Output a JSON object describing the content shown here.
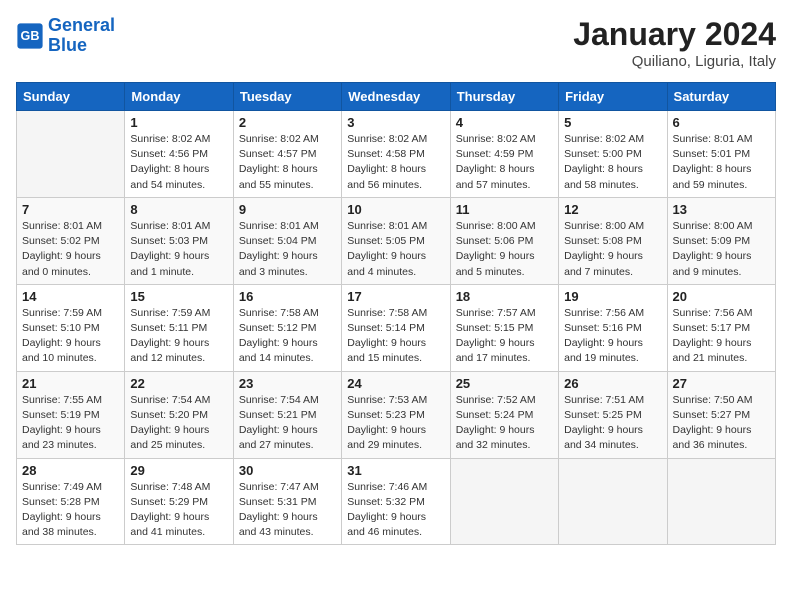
{
  "header": {
    "logo_general": "General",
    "logo_blue": "Blue",
    "month": "January 2024",
    "location": "Quiliano, Liguria, Italy"
  },
  "columns": [
    "Sunday",
    "Monday",
    "Tuesday",
    "Wednesday",
    "Thursday",
    "Friday",
    "Saturday"
  ],
  "weeks": [
    [
      {
        "day": "",
        "info": ""
      },
      {
        "day": "1",
        "info": "Sunrise: 8:02 AM\nSunset: 4:56 PM\nDaylight: 8 hours\nand 54 minutes."
      },
      {
        "day": "2",
        "info": "Sunrise: 8:02 AM\nSunset: 4:57 PM\nDaylight: 8 hours\nand 55 minutes."
      },
      {
        "day": "3",
        "info": "Sunrise: 8:02 AM\nSunset: 4:58 PM\nDaylight: 8 hours\nand 56 minutes."
      },
      {
        "day": "4",
        "info": "Sunrise: 8:02 AM\nSunset: 4:59 PM\nDaylight: 8 hours\nand 57 minutes."
      },
      {
        "day": "5",
        "info": "Sunrise: 8:02 AM\nSunset: 5:00 PM\nDaylight: 8 hours\nand 58 minutes."
      },
      {
        "day": "6",
        "info": "Sunrise: 8:01 AM\nSunset: 5:01 PM\nDaylight: 8 hours\nand 59 minutes."
      }
    ],
    [
      {
        "day": "7",
        "info": "Sunrise: 8:01 AM\nSunset: 5:02 PM\nDaylight: 9 hours\nand 0 minutes."
      },
      {
        "day": "8",
        "info": "Sunrise: 8:01 AM\nSunset: 5:03 PM\nDaylight: 9 hours\nand 1 minute."
      },
      {
        "day": "9",
        "info": "Sunrise: 8:01 AM\nSunset: 5:04 PM\nDaylight: 9 hours\nand 3 minutes."
      },
      {
        "day": "10",
        "info": "Sunrise: 8:01 AM\nSunset: 5:05 PM\nDaylight: 9 hours\nand 4 minutes."
      },
      {
        "day": "11",
        "info": "Sunrise: 8:00 AM\nSunset: 5:06 PM\nDaylight: 9 hours\nand 5 minutes."
      },
      {
        "day": "12",
        "info": "Sunrise: 8:00 AM\nSunset: 5:08 PM\nDaylight: 9 hours\nand 7 minutes."
      },
      {
        "day": "13",
        "info": "Sunrise: 8:00 AM\nSunset: 5:09 PM\nDaylight: 9 hours\nand 9 minutes."
      }
    ],
    [
      {
        "day": "14",
        "info": "Sunrise: 7:59 AM\nSunset: 5:10 PM\nDaylight: 9 hours\nand 10 minutes."
      },
      {
        "day": "15",
        "info": "Sunrise: 7:59 AM\nSunset: 5:11 PM\nDaylight: 9 hours\nand 12 minutes."
      },
      {
        "day": "16",
        "info": "Sunrise: 7:58 AM\nSunset: 5:12 PM\nDaylight: 9 hours\nand 14 minutes."
      },
      {
        "day": "17",
        "info": "Sunrise: 7:58 AM\nSunset: 5:14 PM\nDaylight: 9 hours\nand 15 minutes."
      },
      {
        "day": "18",
        "info": "Sunrise: 7:57 AM\nSunset: 5:15 PM\nDaylight: 9 hours\nand 17 minutes."
      },
      {
        "day": "19",
        "info": "Sunrise: 7:56 AM\nSunset: 5:16 PM\nDaylight: 9 hours\nand 19 minutes."
      },
      {
        "day": "20",
        "info": "Sunrise: 7:56 AM\nSunset: 5:17 PM\nDaylight: 9 hours\nand 21 minutes."
      }
    ],
    [
      {
        "day": "21",
        "info": "Sunrise: 7:55 AM\nSunset: 5:19 PM\nDaylight: 9 hours\nand 23 minutes."
      },
      {
        "day": "22",
        "info": "Sunrise: 7:54 AM\nSunset: 5:20 PM\nDaylight: 9 hours\nand 25 minutes."
      },
      {
        "day": "23",
        "info": "Sunrise: 7:54 AM\nSunset: 5:21 PM\nDaylight: 9 hours\nand 27 minutes."
      },
      {
        "day": "24",
        "info": "Sunrise: 7:53 AM\nSunset: 5:23 PM\nDaylight: 9 hours\nand 29 minutes."
      },
      {
        "day": "25",
        "info": "Sunrise: 7:52 AM\nSunset: 5:24 PM\nDaylight: 9 hours\nand 32 minutes."
      },
      {
        "day": "26",
        "info": "Sunrise: 7:51 AM\nSunset: 5:25 PM\nDaylight: 9 hours\nand 34 minutes."
      },
      {
        "day": "27",
        "info": "Sunrise: 7:50 AM\nSunset: 5:27 PM\nDaylight: 9 hours\nand 36 minutes."
      }
    ],
    [
      {
        "day": "28",
        "info": "Sunrise: 7:49 AM\nSunset: 5:28 PM\nDaylight: 9 hours\nand 38 minutes."
      },
      {
        "day": "29",
        "info": "Sunrise: 7:48 AM\nSunset: 5:29 PM\nDaylight: 9 hours\nand 41 minutes."
      },
      {
        "day": "30",
        "info": "Sunrise: 7:47 AM\nSunset: 5:31 PM\nDaylight: 9 hours\nand 43 minutes."
      },
      {
        "day": "31",
        "info": "Sunrise: 7:46 AM\nSunset: 5:32 PM\nDaylight: 9 hours\nand 46 minutes."
      },
      {
        "day": "",
        "info": ""
      },
      {
        "day": "",
        "info": ""
      },
      {
        "day": "",
        "info": ""
      }
    ]
  ]
}
